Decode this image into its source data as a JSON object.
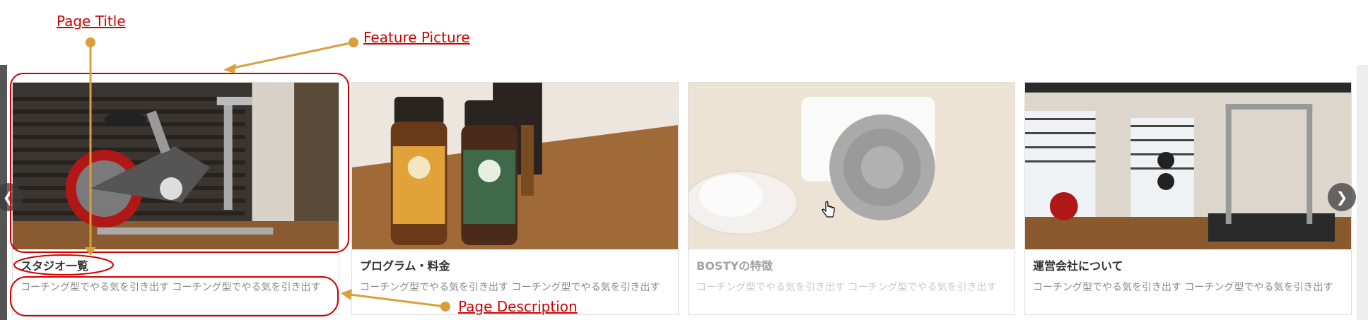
{
  "annotations": {
    "page_title": "Page Title",
    "feature_picture": "Feature Picture",
    "page_description": "Page Description"
  },
  "cards": [
    {
      "title": "スタジオ一覧",
      "description": "コーチング型でやる気を引き出す コーチング型でやる気を引き出す",
      "photo": "exercise-bike-photo",
      "state": "normal"
    },
    {
      "title": "プログラム・料金",
      "description": "コーチング型でやる気を引き出す コーチング型でやる気を引き出す",
      "photo": "essential-oil-bottles-photo",
      "state": "normal"
    },
    {
      "title": "BOSTYの特徴",
      "description": "コーチング型でやる気を引き出す コーチング型でやる気を引き出す",
      "photo": "camera-photo",
      "state": "faded"
    },
    {
      "title": "運営会社について",
      "description": "コーチング型でやる気を引き出す コーチング型でやる気を引き出す",
      "photo": "gym-interior-photo",
      "state": "normal"
    }
  ],
  "colors": {
    "annotation_red": "#d00000",
    "pointer_gold": "#d9a03a",
    "title_text": "#333333",
    "desc_text": "#888888"
  },
  "icons": {
    "prev": "chevron-left-icon",
    "next": "chevron-right-icon",
    "cursor": "hand-pointer-icon"
  }
}
